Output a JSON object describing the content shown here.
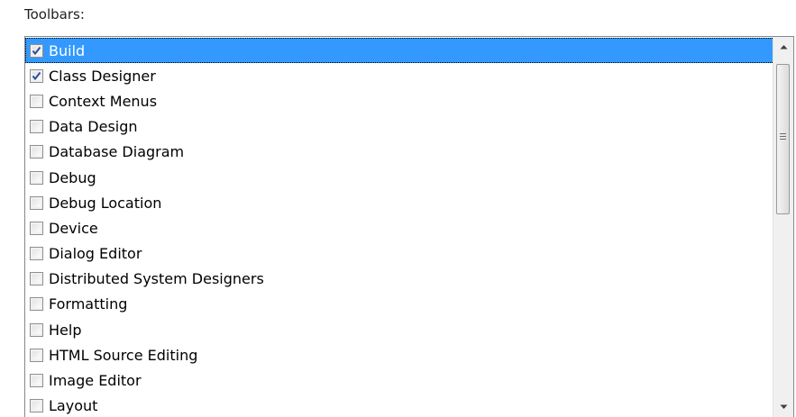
{
  "panel": {
    "label": "Toolbars:"
  },
  "toolbars": [
    {
      "label": "Build",
      "checked": true,
      "selected": true
    },
    {
      "label": "Class Designer",
      "checked": true,
      "selected": false
    },
    {
      "label": "Context Menus",
      "checked": false,
      "selected": false
    },
    {
      "label": "Data Design",
      "checked": false,
      "selected": false
    },
    {
      "label": "Database Diagram",
      "checked": false,
      "selected": false
    },
    {
      "label": "Debug",
      "checked": false,
      "selected": false
    },
    {
      "label": "Debug Location",
      "checked": false,
      "selected": false
    },
    {
      "label": "Device",
      "checked": false,
      "selected": false
    },
    {
      "label": "Dialog Editor",
      "checked": false,
      "selected": false
    },
    {
      "label": "Distributed System Designers",
      "checked": false,
      "selected": false
    },
    {
      "label": "Formatting",
      "checked": false,
      "selected": false
    },
    {
      "label": "Help",
      "checked": false,
      "selected": false
    },
    {
      "label": "HTML Source Editing",
      "checked": false,
      "selected": false
    },
    {
      "label": "Image Editor",
      "checked": false,
      "selected": false
    },
    {
      "label": "Layout",
      "checked": false,
      "selected": false
    }
  ],
  "icons": {
    "check": "check-icon",
    "scroll_up": "arrow-up-icon",
    "scroll_down": "arrow-down-icon",
    "grip": "grip-icon"
  },
  "colors": {
    "selection": "#3399ff",
    "check": "#2a4f9e"
  }
}
